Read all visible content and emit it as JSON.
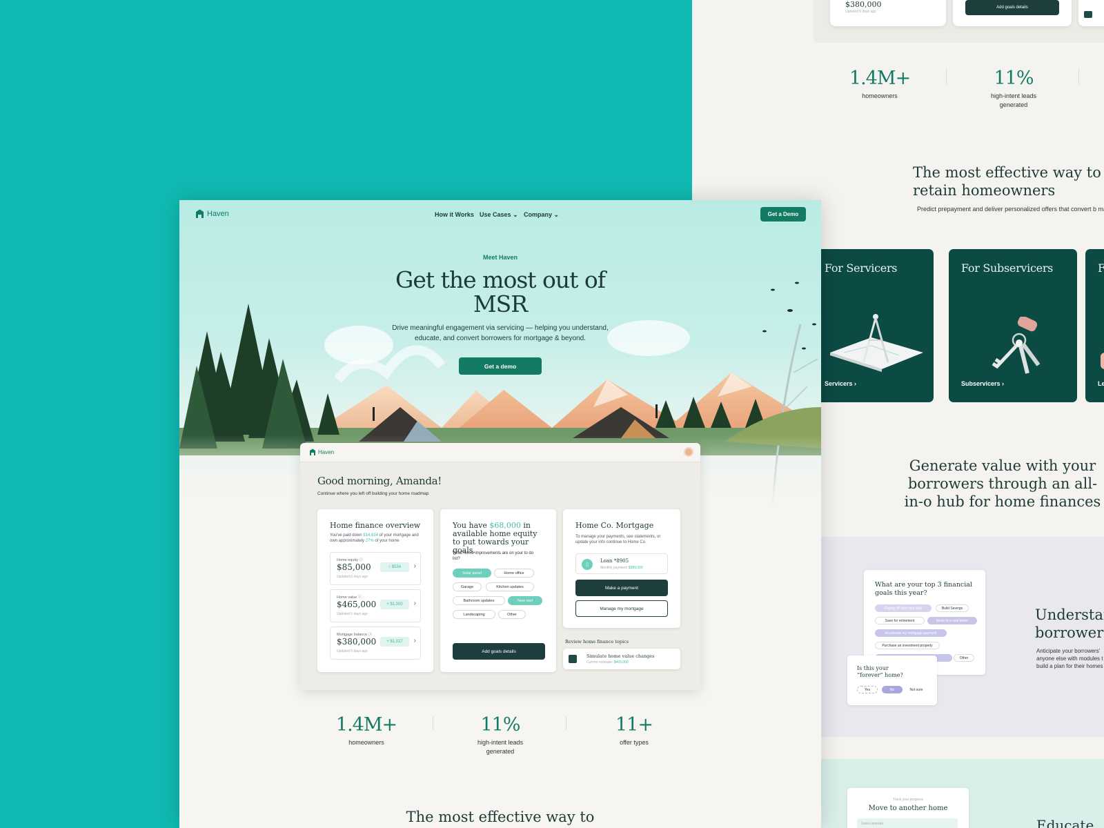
{
  "brand": {
    "name": "Haven"
  },
  "nav": {
    "links": [
      "How it Works",
      "Use Cases",
      "Company"
    ],
    "cta": "Get a Demo"
  },
  "hero": {
    "eyebrow": "Meet Haven",
    "title": "Get the most out of MSR",
    "subtitle": "Drive meaningful engagement via servicing — helping you understand, educate, and convert borrowers for mortgage & beyond.",
    "cta": "Get a demo"
  },
  "dashboard": {
    "brand": "Haven",
    "greeting": "Good morning, Amanda!",
    "subgreeting": "Continue where you left off building your home roadmap",
    "overview": {
      "title": "Home finance overview",
      "desc_pre": "You've paid down ",
      "paid": "$14,634",
      "desc_mid": " of your mortgage and own approximately ",
      "owned": "27%",
      "desc_post": " of your home",
      "rows": [
        {
          "label": "Home equity ⓘ",
          "value": "$85,000",
          "delta": "↑ $534",
          "updated": "Updated 6 days ago"
        },
        {
          "label": "Home value ⓘ",
          "value": "$465,000",
          "delta": "+ $1,000",
          "updated": "Updated 5 days ago"
        },
        {
          "label": "Mortgage balance ⓘ",
          "value": "$380,000",
          "delta": "+ $1,027",
          "updated": "Updated 5 days ago"
        }
      ]
    },
    "goals": {
      "title_pre": "You have ",
      "amount": "$68,000",
      "title_post": " in available home equity to put towards your goals.",
      "question": "What home improvements are on your to do list?",
      "chips": [
        "Solar panel",
        "Home office",
        "Garage",
        "Kitchen updates",
        "Bathroom updates",
        "New roof",
        "Landscaping",
        "Other"
      ],
      "cta": "Add goals details"
    },
    "mortgage": {
      "title": "Home Co. Mortgage",
      "desc": "To manage your payments, see statements, or update your info continue to Home Co.",
      "loan": "Loan *8905",
      "monthly_label": "Monthly payment: ",
      "monthly": "$389,000",
      "pay": "Make a payment",
      "manage": "Manage my mortgage"
    },
    "topics": {
      "heading": "Review home finance topics",
      "item": "Simulate home value changes",
      "item_sub_pre": "Current estimate: ",
      "item_sub_val": "$465,000"
    }
  },
  "stats": [
    {
      "num": "1.4M+",
      "label": "homeowners"
    },
    {
      "num": "11%",
      "label": "high-intent leads generated"
    },
    {
      "num": "11+",
      "label": "offer types"
    }
  ],
  "section_title_partial": "The most effective way to",
  "back": {
    "top_value": "$380,000",
    "top_updated": "Updated 5 days ago",
    "top_cta": "Add goals details",
    "stats": [
      {
        "num": "1.4M+",
        "label": "homeowners"
      },
      {
        "num": "11%",
        "label": "high-intent leads generated"
      }
    ],
    "title": "The most effective way to retain homeowners",
    "desc": "Predict prepayment and deliver personalized offers that convert b making the tough decisions of homeownership simple and intuitiv",
    "cards": [
      {
        "title": "For Servicers",
        "link": "Servicers ›"
      },
      {
        "title": "For Subservicers",
        "link": "Subservicers ›"
      },
      {
        "title": "F",
        "link": "Le"
      }
    ],
    "generate": "Generate value with your borrowers through an all-in-o hub for home finances",
    "quiz": {
      "question": "What are your top 3 financial goals this year?",
      "chips": [
        "Paying off high cost debt",
        "Build Savings",
        "Save for retirement",
        "Move to a new home",
        "Accelerate my mortgage payment",
        "Purchase an investment property",
        "",
        "Other"
      ]
    },
    "forever": {
      "question": "Is this your “forever” home?",
      "options": [
        "Yes",
        "No",
        "Not sure"
      ]
    },
    "understand": "Understan borrower i",
    "understand_desc": "Anticipate your borrowers' anyone else with modules t build a plan for their homes",
    "educate_card_sub": "Track your progress",
    "educate_card_title": "Move to another home",
    "educate_field": "Select amount",
    "educate": "Educate"
  },
  "colors": {
    "teal": "#10bab2",
    "brand_green": "#137a63",
    "dark_green": "#0c4a44",
    "mint": "#6ecfbd"
  }
}
